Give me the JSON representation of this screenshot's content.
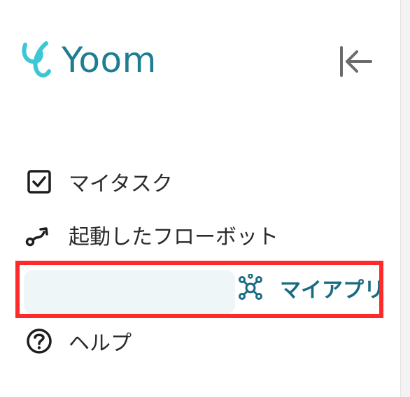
{
  "app": {
    "logo_text": "Yoom"
  },
  "colors": {
    "brand": "#1d7d93",
    "logo_mark": "#3cc6d6",
    "active_text": "#1a6b82",
    "active_bg": "#eef6f8",
    "highlight": "#ff2a2a"
  },
  "header": {
    "collapse_icon": "collapse-left-icon"
  },
  "nav": {
    "items": [
      {
        "label": "マイタスク",
        "icon": "checkbox-icon",
        "active": false
      },
      {
        "label": "起動したフローボット",
        "icon": "flow-icon",
        "active": false
      },
      {
        "label": "マイアプリ",
        "icon": "network-icon",
        "active": true
      },
      {
        "label": "ヘルプ",
        "icon": "help-icon",
        "active": false
      }
    ]
  }
}
